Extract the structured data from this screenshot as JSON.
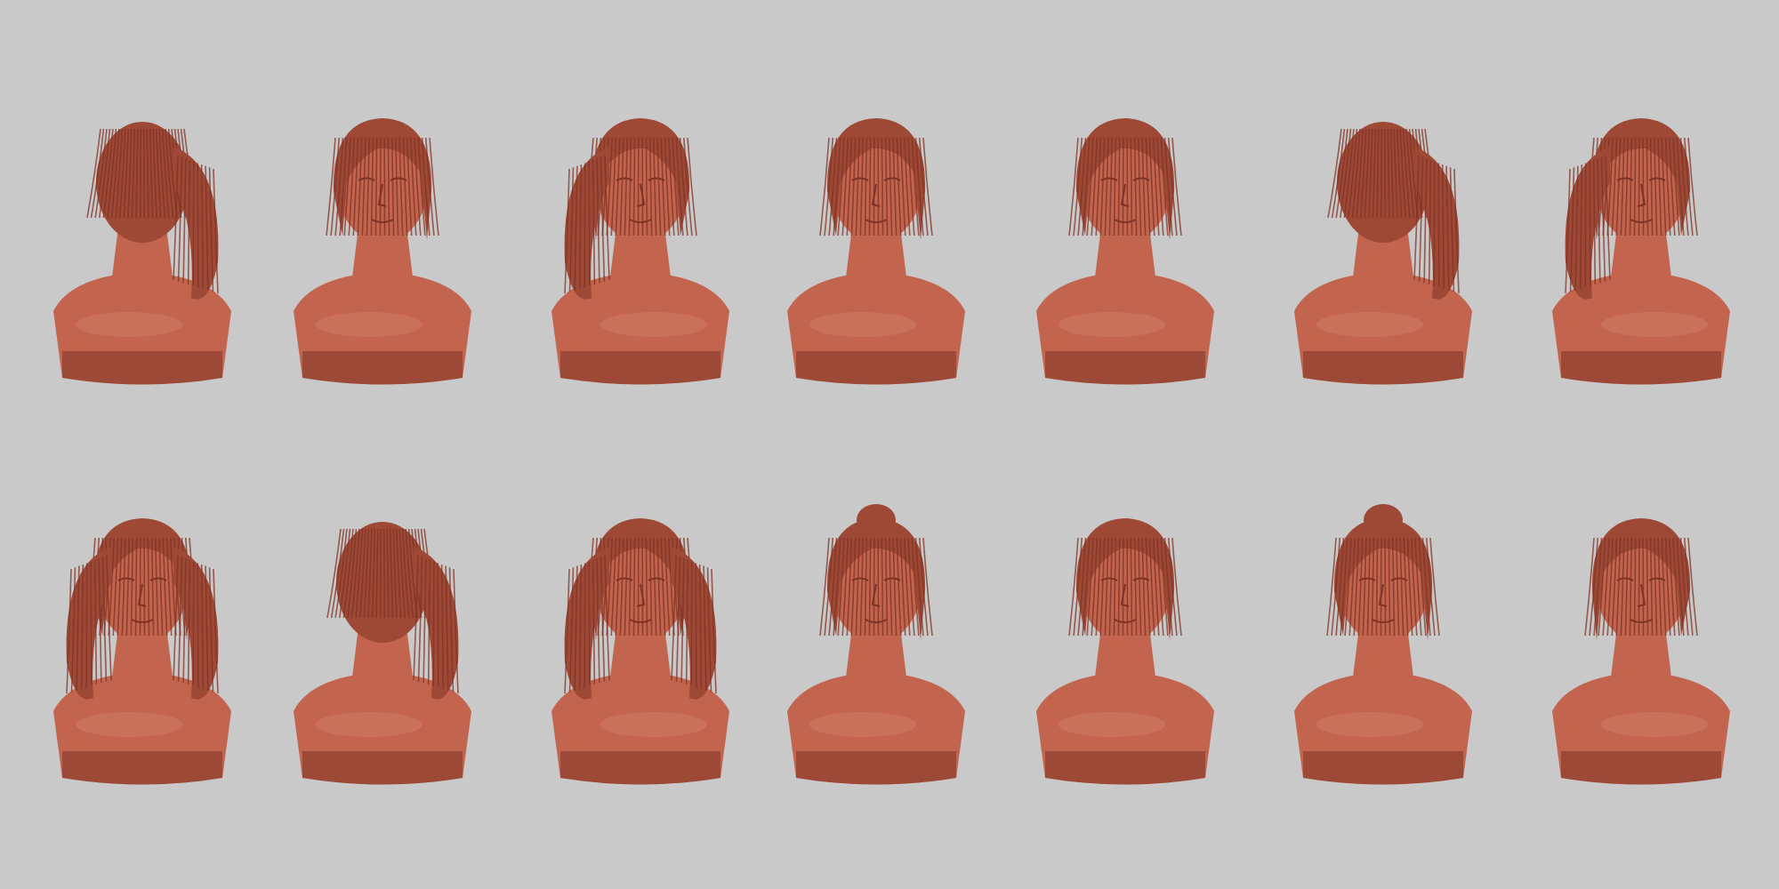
{
  "scene": {
    "background_color": "#c9c9c9",
    "material_color": "#c2644e",
    "hair_color": "#9e4836",
    "shadow_color": "#7f3325",
    "highlight_color": "#d98a74",
    "rows": [
      {
        "busts": [
          {
            "view": "back",
            "hair": "ponytail"
          },
          {
            "view": "three-quarter-right",
            "hair": "bangs"
          },
          {
            "view": "side-left",
            "hair": "ponytail"
          },
          {
            "view": "front-low",
            "hair": "bangs"
          },
          {
            "view": "front",
            "hair": "bangs"
          },
          {
            "view": "back-three-quarter",
            "hair": "ponytail"
          },
          {
            "view": "tilted-up-left",
            "hair": "ponytail"
          }
        ]
      },
      {
        "busts": [
          {
            "view": "three-quarter-right",
            "hair": "pigtails"
          },
          {
            "view": "back-top",
            "hair": "ponytail"
          },
          {
            "view": "three-quarter-left",
            "hair": "pigtails"
          },
          {
            "view": "top-down",
            "hair": "topknot"
          },
          {
            "view": "front",
            "hair": "bangs"
          },
          {
            "view": "top-down-right",
            "hair": "topknot"
          },
          {
            "view": "three-quarter-left",
            "hair": "bangs"
          }
        ]
      }
    ]
  }
}
